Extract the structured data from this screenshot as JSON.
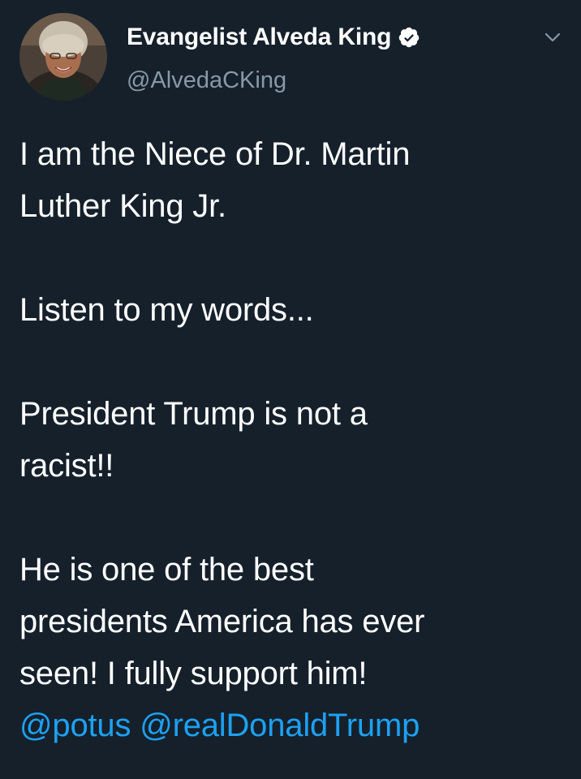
{
  "author": {
    "display_name": "Evangelist Alveda King",
    "handle": "@AlvedaCKing",
    "verified": true,
    "avatar_icon": "profile-photo-icon",
    "verified_icon": "verified-badge-icon",
    "menu_icon": "chevron-down-icon"
  },
  "tweet": {
    "para1_line1": "I am the Niece of Dr. Martin",
    "para1_line2": "Luther King Jr.",
    "para2_line1": "Listen to my words...",
    "para3_line1": "President Trump is not a",
    "para3_line2": "racist!!",
    "para4_line1": "He is one of the best",
    "para4_line2": "presidents America has ever",
    "para4_line3": "seen! I fully support him!",
    "mention1": "@potus",
    "mention2": "@realDonaldTrump"
  },
  "colors": {
    "background": "#15202b",
    "text": "#ffffff",
    "secondary": "#8899a6",
    "link": "#1da1f2"
  }
}
